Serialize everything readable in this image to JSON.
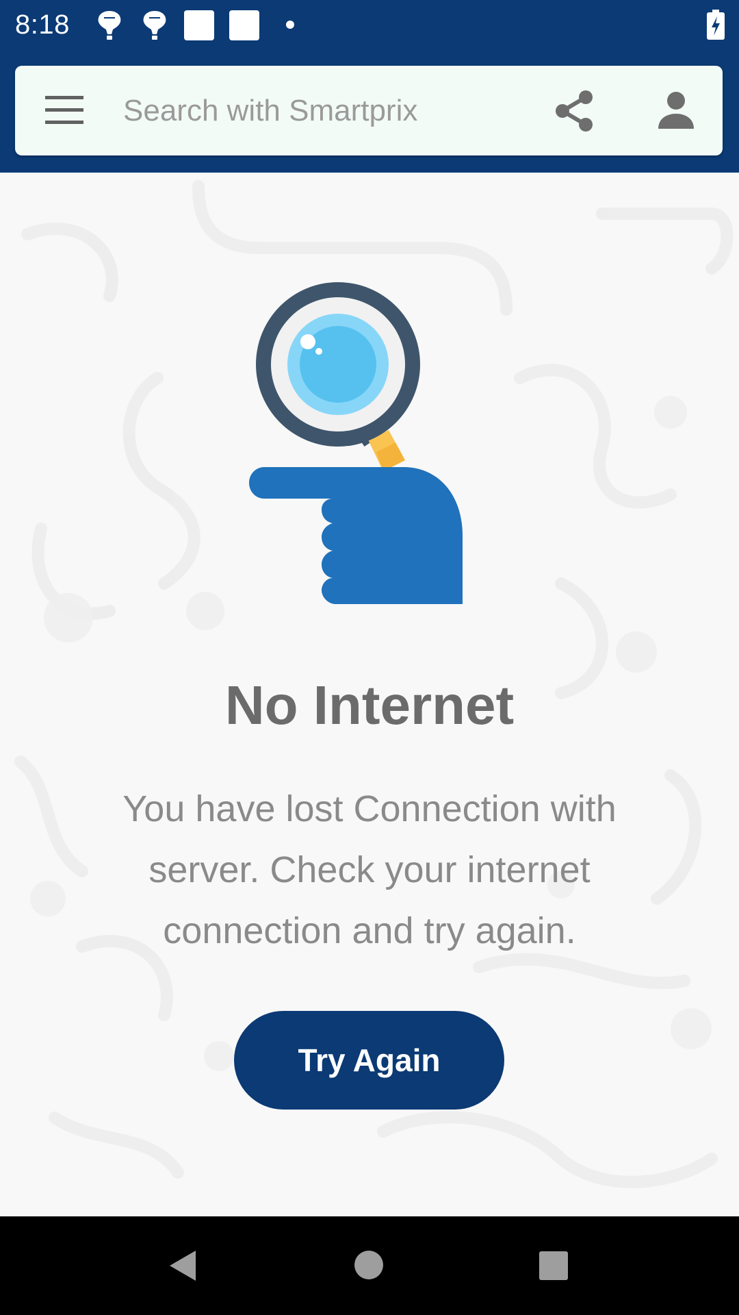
{
  "status_bar": {
    "time": "8:18",
    "icons": [
      "hot-air-balloon-icon",
      "hot-air-balloon-icon",
      "square-notification-icon",
      "square-notification-icon",
      "dot-icon"
    ],
    "battery": "battery-charging-icon"
  },
  "search": {
    "placeholder": "Search with Smartprix",
    "value": "",
    "menu_icon": "menu-icon",
    "share_icon": "share-icon",
    "profile_icon": "person-icon"
  },
  "content": {
    "illustration": "magnifier-hand-icon",
    "title": "No Internet",
    "message": "You have lost Connection with server. Check your internet connection and try again.",
    "button_label": "Try Again"
  },
  "nav": {
    "back": "back-triangle-icon",
    "home": "home-circle-icon",
    "recents": "recents-square-icon"
  },
  "colors": {
    "brand_blue": "#0b3a75",
    "search_bg": "#f3fbf7",
    "title": "#6b6b6b",
    "message": "#8a8a8a",
    "hand_blue": "#1f72bb",
    "lens_blue": "#56c1ef",
    "magnifier_frame": "#3f556b",
    "handle_yellow": "#f9c451"
  }
}
